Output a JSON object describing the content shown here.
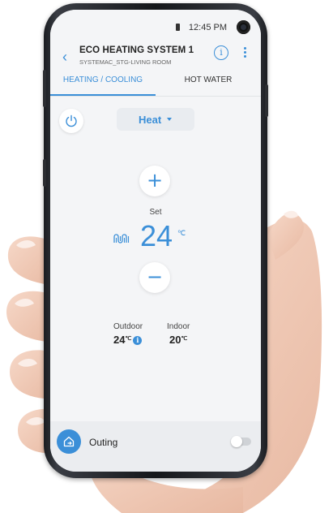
{
  "status_bar": {
    "time": "12:45 PM"
  },
  "header": {
    "title": "ECO HEATING SYSTEM 1",
    "subtitle": "SYSTEMAC_STG-LIVING ROOM",
    "back_icon": "chevron-left-icon",
    "info_icon": "info-icon",
    "more_icon": "more-vertical-icon"
  },
  "tabs": [
    {
      "label": "HEATING / COOLING",
      "active": true
    },
    {
      "label": "HOT WATER",
      "active": false
    }
  ],
  "controls": {
    "power_icon": "power-icon",
    "mode": "Heat",
    "increase_symbol": "+",
    "decrease_symbol": "−",
    "set_label": "Set",
    "set_temperature": "24",
    "set_unit": "℃",
    "heating_icon": "floor-heating-icon"
  },
  "readings": {
    "outdoor_label": "Outdoor",
    "outdoor_value": "24",
    "outdoor_unit": "℃",
    "indoor_label": "Indoor",
    "indoor_value": "20",
    "indoor_unit": "℃"
  },
  "bottom": {
    "outing_label": "Outing",
    "outing_icon": "home-exit-icon",
    "outing_enabled": false
  },
  "colors": {
    "accent": "#3b8fd8",
    "screen_bg": "#f4f5f7",
    "bottom_bar_bg": "#ebedf0"
  }
}
